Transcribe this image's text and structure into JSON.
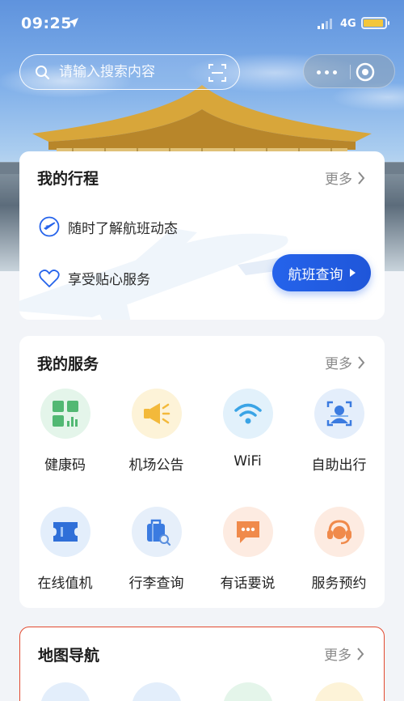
{
  "status_bar": {
    "time": "09:25",
    "network": "4G"
  },
  "search": {
    "placeholder": "请输入搜索内容"
  },
  "trip": {
    "title": "我的行程",
    "more": "更多",
    "items": [
      {
        "label": "随时了解航班动态",
        "icon": "flight-status-icon"
      },
      {
        "label": "享受贴心服务",
        "icon": "heart-icon"
      }
    ],
    "button": "航班查询"
  },
  "services": {
    "title": "我的服务",
    "more": "更多",
    "items": [
      {
        "label": "健康码",
        "icon": "health-code-icon",
        "bg": "#e4f5ea"
      },
      {
        "label": "机场公告",
        "icon": "announcement-icon",
        "bg": "#fdf3d8"
      },
      {
        "label": "WiFi",
        "icon": "wifi-icon",
        "bg": "#e2f1fb"
      },
      {
        "label": "自助出行",
        "icon": "self-service-icon",
        "bg": "#e4eefb"
      },
      {
        "label": "在线值机",
        "icon": "online-checkin-icon",
        "bg": "#e3eefb"
      },
      {
        "label": "行李查询",
        "icon": "luggage-icon",
        "bg": "#e6effa"
      },
      {
        "label": "有话要说",
        "icon": "message-icon",
        "bg": "#fdebe1"
      },
      {
        "label": "服务预约",
        "icon": "headset-icon",
        "bg": "#fdebe1"
      }
    ]
  },
  "map": {
    "title": "地图导航",
    "more": "更多",
    "accent": "#e2492f"
  },
  "colors": {
    "primary": "#2563eb",
    "health_green": "#52b873",
    "announce_yellow": "#f3b93a",
    "wifi_blue": "#3aa4e6",
    "service_orange": "#f08a4b"
  }
}
